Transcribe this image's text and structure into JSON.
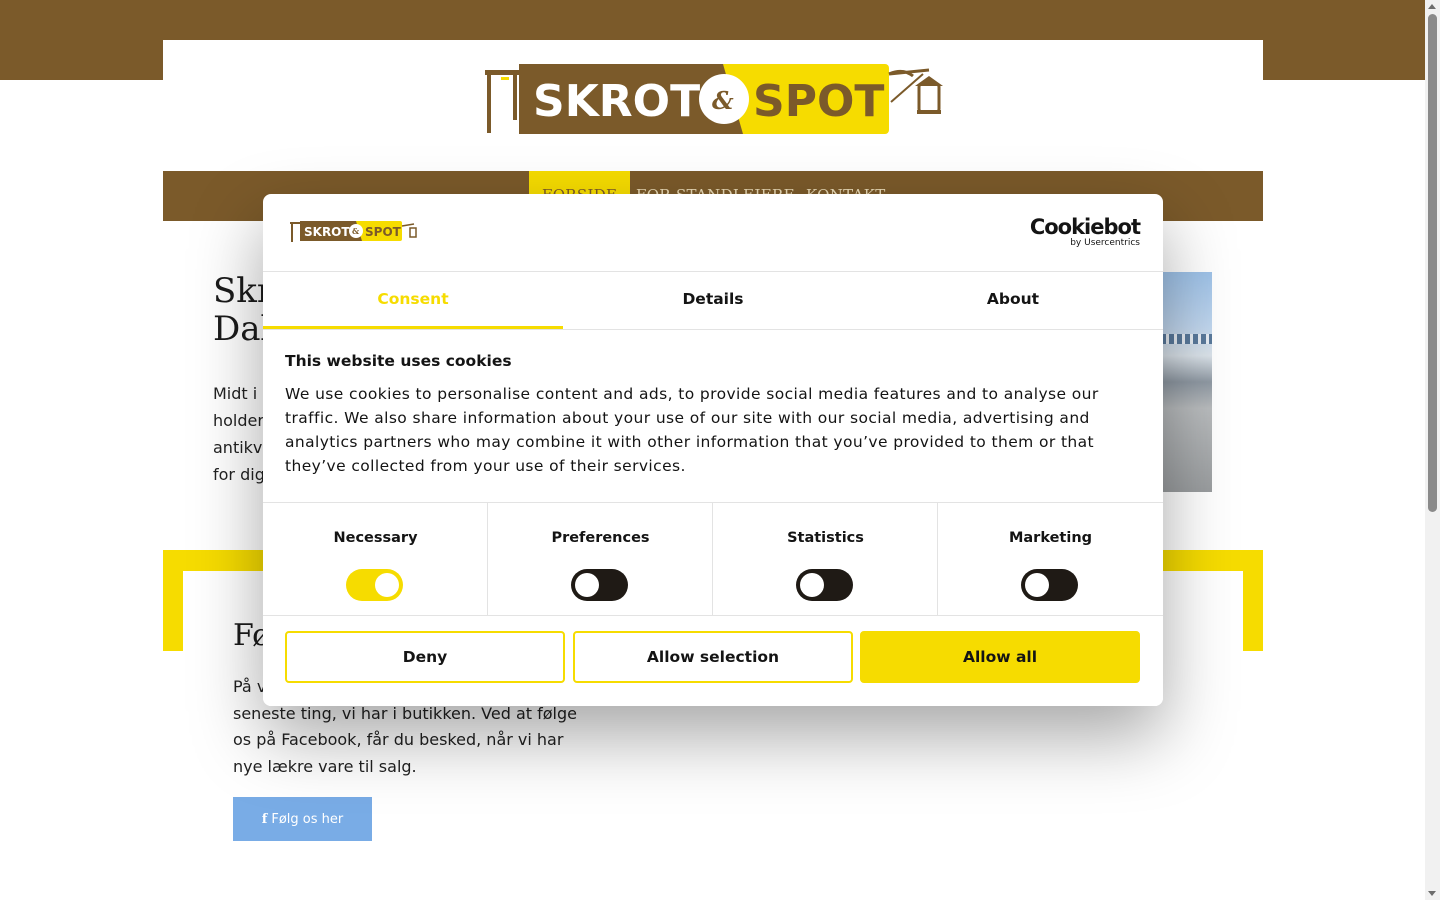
{
  "site": {
    "logo_text_left": "SKROT",
    "logo_amp": "&",
    "logo_text_right": "SPOT",
    "colors": {
      "brand_brown": "#7b5a2a",
      "brand_yellow": "#f6dc00",
      "facebook_blue": "#79ace6"
    }
  },
  "nav": {
    "items": [
      {
        "label": "FORSIDE",
        "active": true
      },
      {
        "label": "FOR STANDLEJERE",
        "active": false
      },
      {
        "label": "KONTAKT",
        "active": false
      }
    ]
  },
  "hero": {
    "title_line1": "Skr",
    "title_line2": "Dal",
    "text_lines": [
      "Midt i d",
      "holder",
      "antikvit",
      "for dig!"
    ]
  },
  "facebook": {
    "title": "Fø",
    "text_line1_clip": "På v",
    "text_rest": "seneste ting, vi har i butikken. Ved at følge os på Facebook, får du besked, når vi har nye lækre vare til salg.",
    "button_icon": "facebook-icon",
    "button_label": "Følg os her"
  },
  "cookie_dialog": {
    "brand": "Cookiebot",
    "brand_sub": "by Usercentrics",
    "tabs": [
      {
        "label": "Consent",
        "active": true
      },
      {
        "label": "Details",
        "active": false
      },
      {
        "label": "About",
        "active": false
      }
    ],
    "heading": "This website uses cookies",
    "body": "We use cookies to personalise content and ads, to provide social media features and to analyse our traffic. We also share information about your use of our site with our social media, advertising and analytics partners who may combine it with other information that you’ve provided to them or that they’ve collected from your use of their services.",
    "toggles": [
      {
        "label": "Necessary",
        "on": true
      },
      {
        "label": "Preferences",
        "on": false
      },
      {
        "label": "Statistics",
        "on": false
      },
      {
        "label": "Marketing",
        "on": false
      }
    ],
    "buttons": {
      "deny": "Deny",
      "allow_selection": "Allow selection",
      "allow_all": "Allow all"
    }
  }
}
